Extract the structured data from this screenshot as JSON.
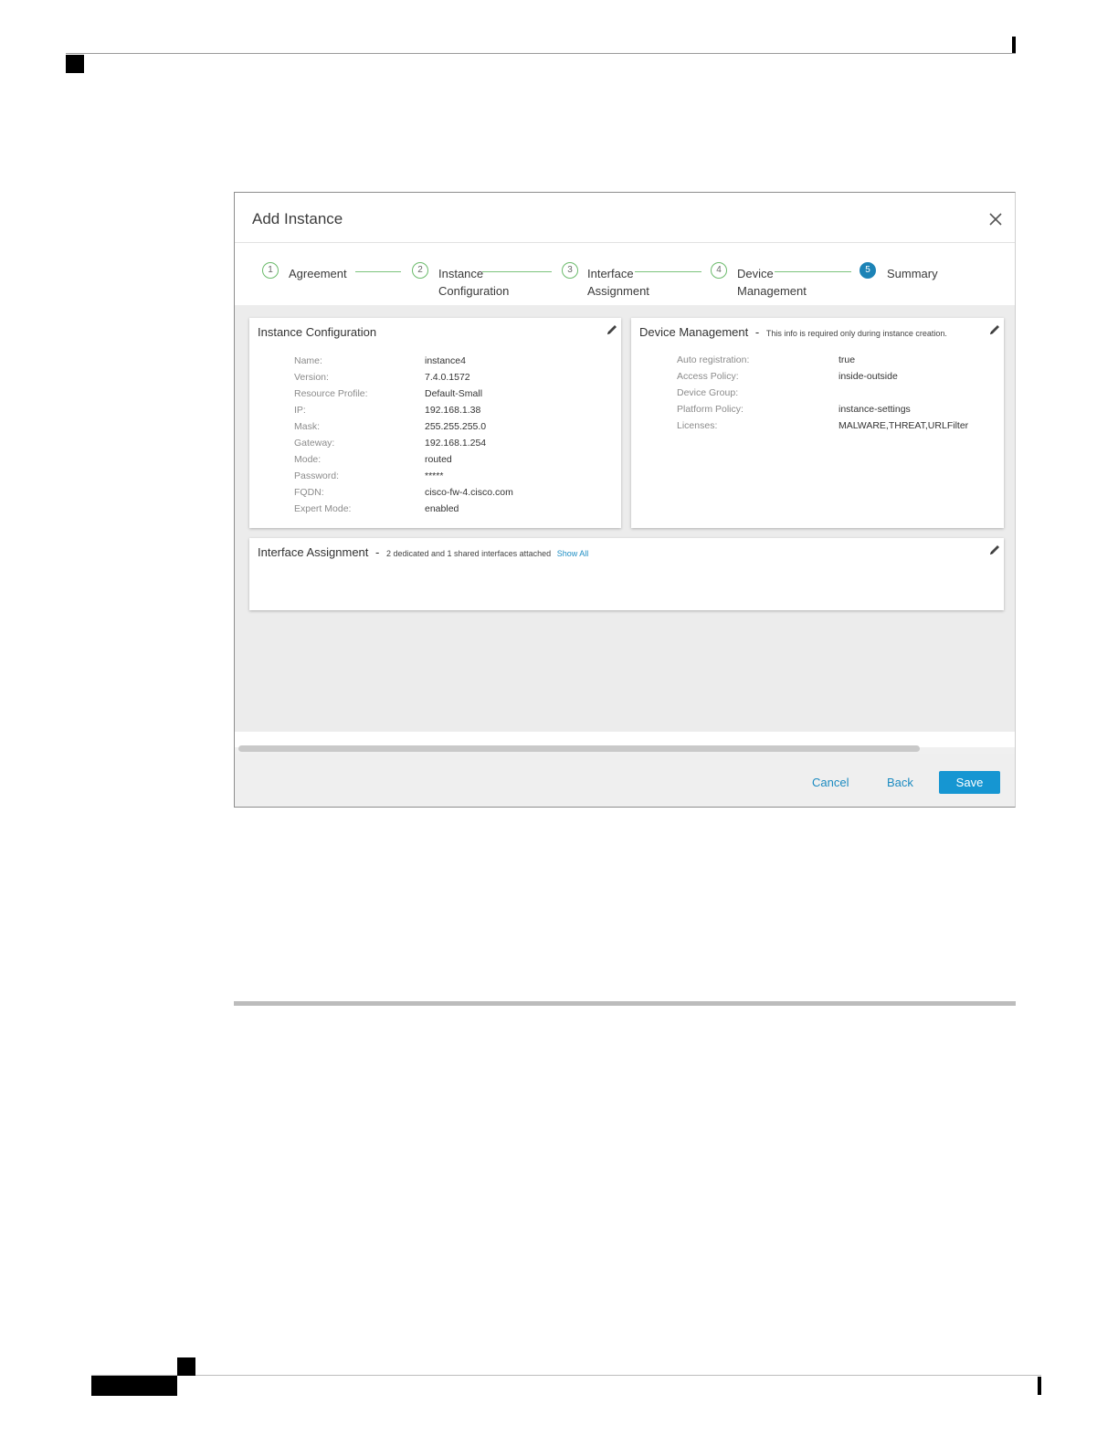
{
  "dialog": {
    "title": "Add Instance",
    "close_icon": "close-icon"
  },
  "stepper": {
    "steps": [
      {
        "number": "1",
        "line1": "Agreement",
        "line2": "",
        "state": "completed"
      },
      {
        "number": "2",
        "line1": "Instance",
        "line2": "Configuration",
        "state": "completed"
      },
      {
        "number": "3",
        "line1": "Interface",
        "line2": "Assignment",
        "state": "completed"
      },
      {
        "number": "4",
        "line1": "Device",
        "line2": "Management",
        "state": "completed"
      },
      {
        "number": "5",
        "line1": "Summary",
        "line2": "",
        "state": "active"
      }
    ]
  },
  "instance_config": {
    "title": "Instance Configuration",
    "edit_icon": "pencil-icon",
    "fields": [
      {
        "label": "Name:",
        "value": "instance4"
      },
      {
        "label": "Version:",
        "value": "7.4.0.1572"
      },
      {
        "label": "Resource Profile:",
        "value": "Default-Small"
      },
      {
        "label": "IP:",
        "value": "192.168.1.38"
      },
      {
        "label": "Mask:",
        "value": "255.255.255.0"
      },
      {
        "label": "Gateway:",
        "value": "192.168.1.254"
      },
      {
        "label": "Mode:",
        "value": "routed"
      },
      {
        "label": "Password:",
        "value": "*****"
      },
      {
        "label": "FQDN:",
        "value": "cisco-fw-4.cisco.com"
      },
      {
        "label": "Expert Mode:",
        "value": "enabled"
      }
    ]
  },
  "device_mgmt": {
    "title": "Device Management",
    "separator": "-",
    "note": "This info is required only during instance creation.",
    "edit_icon": "pencil-icon",
    "fields": [
      {
        "label": "Auto registration:",
        "value": "true"
      },
      {
        "label": "Access Policy:",
        "value": "inside-outside"
      },
      {
        "label": "Device Group:",
        "value": ""
      },
      {
        "label": "Platform Policy:",
        "value": "instance-settings"
      },
      {
        "label": "Licenses:",
        "value": "MALWARE,THREAT,URLFilter"
      }
    ]
  },
  "interface_assignment": {
    "title": "Interface Assignment",
    "separator": "-",
    "note": "2 dedicated and 1 shared interfaces attached",
    "link": "Show All",
    "edit_icon": "pencil-icon"
  },
  "footer": {
    "cancel": "Cancel",
    "back": "Back",
    "save": "Save"
  },
  "colors": {
    "accent": "#1696d2",
    "step_done": "#6cbb6c",
    "step_active": "#1c83b6"
  }
}
